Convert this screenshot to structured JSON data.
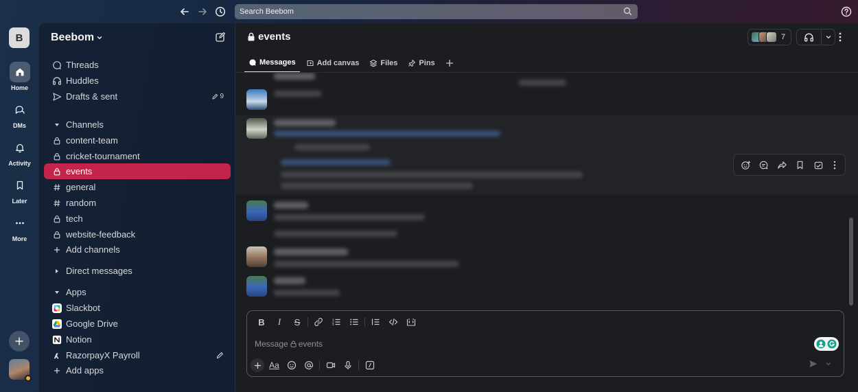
{
  "search": {
    "placeholder": "Search Beebom"
  },
  "icons": {
    "back": "arrow-left-icon",
    "forward": "arrow-right-icon",
    "history": "clock-icon",
    "search": "search-icon",
    "help": "help-circle-icon"
  },
  "colors": {
    "accent": "#c4244b",
    "main_bg": "#1c1d21"
  },
  "rail": {
    "workspace_initial": "B",
    "items": [
      {
        "label": "Home"
      },
      {
        "label": "DMs"
      },
      {
        "label": "Activity"
      },
      {
        "label": "Later"
      },
      {
        "label": "More"
      }
    ]
  },
  "sidebar": {
    "workspace_name": "Beebom",
    "threads": "Threads",
    "huddles": "Huddles",
    "drafts": "Drafts & sent",
    "drafts_count": "9",
    "channels_header": "Channels",
    "channels": [
      {
        "label": "content-team"
      },
      {
        "label": "cricket-tournament"
      },
      {
        "label": "events"
      },
      {
        "label": "general"
      },
      {
        "label": "random"
      },
      {
        "label": "tech"
      },
      {
        "label": "website-feedback"
      }
    ],
    "add_channels": "Add channels",
    "dm_header": "Direct messages",
    "apps_header": "Apps",
    "apps": [
      {
        "label": "Slackbot"
      },
      {
        "label": "Google Drive"
      },
      {
        "label": "Notion"
      },
      {
        "label": "RazorpayX Payroll"
      }
    ],
    "add_apps": "Add apps"
  },
  "channel": {
    "name": "events",
    "member_count": "7",
    "tabs": [
      {
        "label": "Messages"
      },
      {
        "label": "Add canvas"
      },
      {
        "label": "Files"
      },
      {
        "label": "Pins"
      }
    ]
  },
  "composer": {
    "placeholder_prefix": "Message",
    "placeholder_channel": "events",
    "text_format_label": "Aa"
  }
}
